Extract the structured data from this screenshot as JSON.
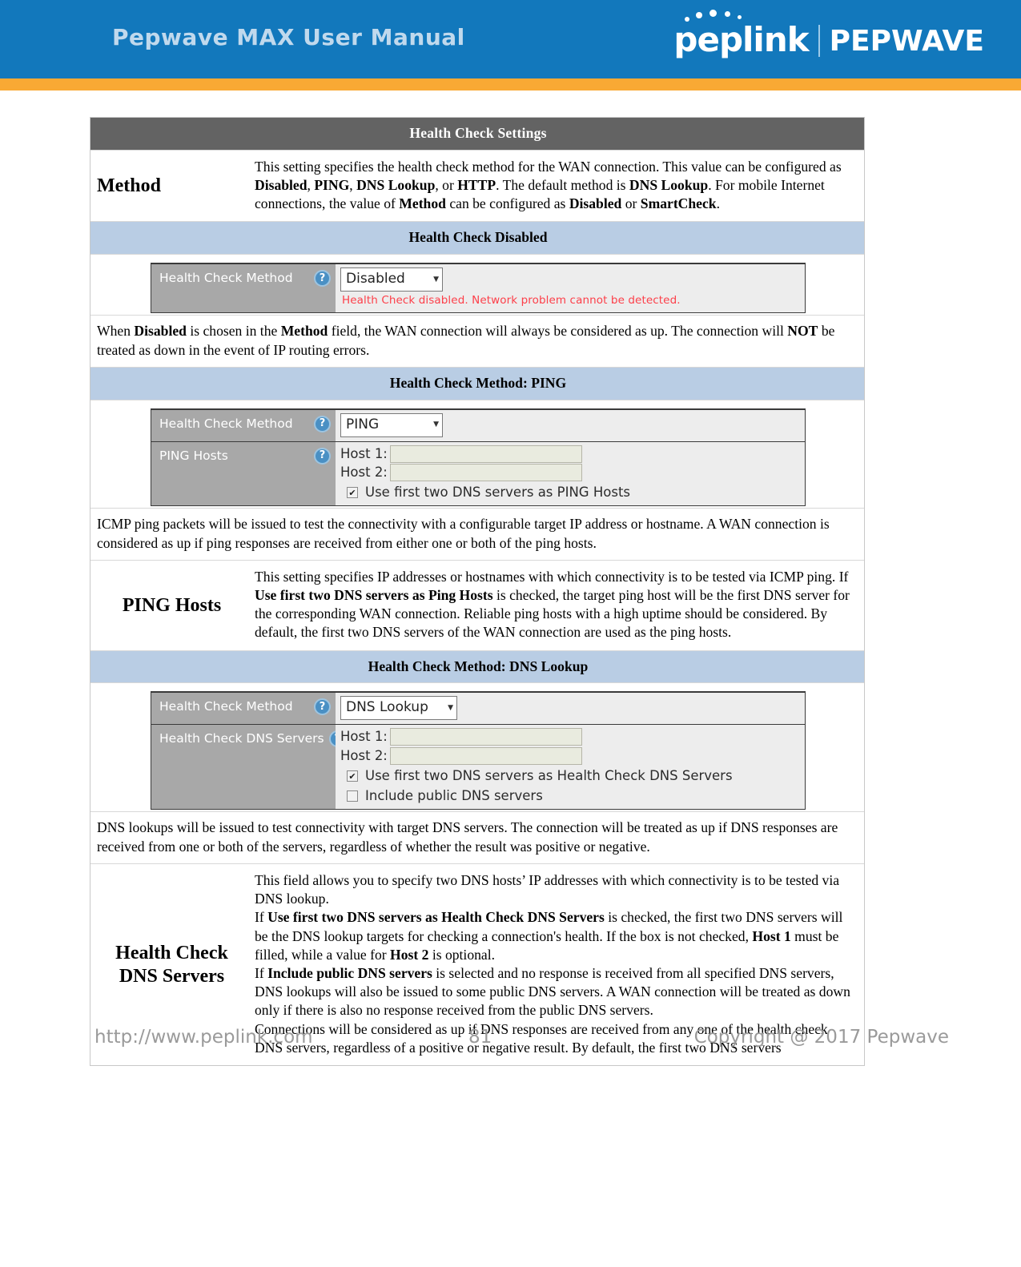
{
  "header": {
    "manual_title": "Pepwave MAX User Manual",
    "brand_left": "peplink",
    "brand_right": "PEPWAVE",
    "bar_color": "#1278bc",
    "accent_color": "#f9a934"
  },
  "table": {
    "title": "Health Check Settings",
    "title_bg": "#636363",
    "section_bg": "#b9cde4",
    "rows": {
      "method": {
        "label": "Method",
        "desc_parts": [
          {
            "t": "This setting specifies the health check method for the WAN connection. This value can be configured as ",
            "b": false
          },
          {
            "t": "Disabled",
            "b": true
          },
          {
            "t": ", ",
            "b": false
          },
          {
            "t": "PING",
            "b": true
          },
          {
            "t": ", ",
            "b": false
          },
          {
            "t": "DNS Lookup",
            "b": true
          },
          {
            "t": ", or ",
            "b": false
          },
          {
            "t": "HTTP",
            "b": true
          },
          {
            "t": ". The default method is ",
            "b": false
          },
          {
            "t": "DNS Lookup",
            "b": true
          },
          {
            "t": ". For mobile Internet connections, the value of ",
            "b": false
          },
          {
            "t": "Method",
            "b": true
          },
          {
            "t": " can be configured as ",
            "b": false
          },
          {
            "t": "Disabled",
            "b": true
          },
          {
            "t": " or ",
            "b": false
          },
          {
            "t": "SmartCheck",
            "b": true
          },
          {
            "t": ".",
            "b": false
          }
        ]
      },
      "disabled_section": {
        "heading": "Health Check Disabled",
        "widget": {
          "method_label": "Health Check Method",
          "help_glyph": "?",
          "method_value": "Disabled",
          "caret_glyph": "▼",
          "warning": "Health Check disabled. Network problem cannot be detected."
        },
        "desc_parts": [
          {
            "t": "When ",
            "b": false
          },
          {
            "t": "Disabled",
            "b": true
          },
          {
            "t": " is chosen in the ",
            "b": false
          },
          {
            "t": "Method",
            "b": true
          },
          {
            "t": " field, the WAN connection will always be considered as up. The connection will ",
            "b": false
          },
          {
            "t": "NOT",
            "b": true
          },
          {
            "t": " be treated as down in the event of IP routing errors.",
            "b": false
          }
        ]
      },
      "ping_section": {
        "heading": "Health Check Method: PING",
        "widget": {
          "method_label": "Health Check Method",
          "method_value": "PING",
          "hosts_label": "PING Hosts",
          "host1_label": "Host 1:",
          "host1_value": "",
          "host2_label": "Host 2:",
          "host2_value": "",
          "checkbox_label": "Use first two DNS servers as PING Hosts",
          "checkbox_checked": true,
          "check_glyph": "✔"
        },
        "desc_parts": [
          {
            "t": "ICMP ping packets will be issued to test the connectivity with a configurable target IP address or hostname. A WAN connection is considered as up if ping responses are received from either one or both of the ping hosts.",
            "b": false
          }
        ]
      },
      "ping_hosts": {
        "label": "PING Hosts",
        "desc_parts": [
          {
            "t": "This setting specifies IP addresses or hostnames with which connectivity is to be tested via ICMP ping. If ",
            "b": false
          },
          {
            "t": "Use first two DNS servers as Ping Hosts",
            "b": true
          },
          {
            "t": " is checked, the target ping host will be the first DNS server for the corresponding WAN connection. Reliable ping hosts with a high uptime should be considered. By default, the first two DNS servers of the WAN connection are used as the ping hosts.",
            "b": false
          }
        ]
      },
      "dns_section": {
        "heading": "Health Check Method: DNS Lookup",
        "widget": {
          "method_label": "Health Check Method",
          "method_value": "DNS Lookup",
          "servers_label": "Health Check DNS Servers",
          "host1_label": "Host 1:",
          "host1_value": "",
          "host2_label": "Host 2:",
          "host2_value": "",
          "checkbox1_label": "Use first two DNS servers as Health Check DNS Servers",
          "checkbox1_checked": true,
          "checkbox2_label": "Include public DNS servers",
          "checkbox2_checked": false,
          "check_glyph": "✔"
        },
        "desc_parts": [
          {
            "t": "DNS lookups will be issued to test connectivity with target DNS servers. The connection will be treated as up if DNS responses are received from one or both of the servers, regardless of whether the result was positive or negative.",
            "b": false
          }
        ]
      },
      "dns_servers": {
        "label_line1": "Health Check",
        "label_line2": "DNS Servers",
        "desc_parts": [
          {
            "t": "This field allows you to specify two DNS hosts’ IP addresses with which connectivity is to be tested via DNS lookup.",
            "b": false
          },
          {
            "t": "\n",
            "b": false
          },
          {
            "t": "If ",
            "b": false
          },
          {
            "t": "Use first two DNS servers as Health Check DNS Servers",
            "b": true
          },
          {
            "t": " is checked, the first two DNS servers will be the DNS lookup targets for checking a connection's health. If the box is not checked, ",
            "b": false
          },
          {
            "t": "Host 1",
            "b": true
          },
          {
            "t": " must be filled, while a value for ",
            "b": false
          },
          {
            "t": "Host 2",
            "b": true
          },
          {
            "t": " is optional.",
            "b": false
          },
          {
            "t": "\n",
            "b": false
          },
          {
            "t": "If ",
            "b": false
          },
          {
            "t": "Include public DNS servers",
            "b": true
          },
          {
            "t": " is selected and no response is received from all specified DNS servers, DNS lookups will also be issued to some public DNS servers. A WAN connection will be treated as down only if there is also no response received from the public DNS servers.",
            "b": false
          },
          {
            "t": "\n",
            "b": false
          },
          {
            "t": "Connections will be considered as up if DNS responses are received from any one of the health check DNS servers, regardless of a positive or negative result. By default, the first two DNS servers",
            "b": false
          }
        ]
      }
    }
  },
  "footer": {
    "url": "http://www.peplink.com",
    "page_number": "81",
    "copyright": "Copyright @ 2017 Pepwave"
  }
}
